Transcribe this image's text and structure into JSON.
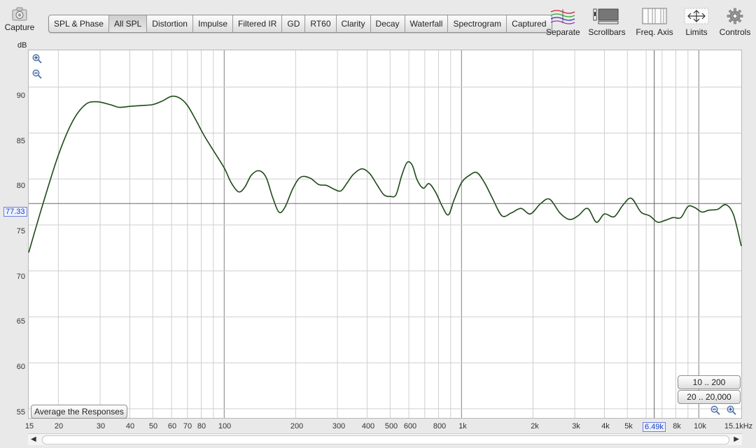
{
  "toolbar": {
    "capture_label": "Capture",
    "tabs": [
      "SPL & Phase",
      "All SPL",
      "Distortion",
      "Impulse",
      "Filtered IR",
      "GD",
      "RT60",
      "Clarity",
      "Decay",
      "Waterfall",
      "Spectrogram",
      "Captured"
    ],
    "active_tab": "All SPL",
    "tools": [
      "Separate",
      "Scrollbars",
      "Freq. Axis",
      "Limits",
      "Controls"
    ]
  },
  "graph": {
    "y_unit": "dB",
    "y_ticks": [
      "90",
      "85",
      "80",
      "75",
      "70",
      "65",
      "60",
      "55"
    ],
    "x_ticks": [
      "15",
      "20",
      "30",
      "40",
      "50",
      "60",
      "70",
      "80",
      "100",
      "200",
      "300",
      "400",
      "500",
      "600",
      "800",
      "1k",
      "2k",
      "3k",
      "4k",
      "5k",
      "6.49k",
      "8k",
      "10k",
      "15.1kHz"
    ],
    "cursor_y_label": "77.33",
    "cursor_x_label": "6.49k",
    "range_buttons": [
      "10 .. 200",
      "20 .. 20,000"
    ],
    "average_button": "Average the Responses"
  },
  "chart_data": {
    "type": "line",
    "xscale": "log",
    "xlim": [
      15,
      15100
    ],
    "ylim": [
      54,
      94
    ],
    "cursor": {
      "x": 6490,
      "y": 77.33
    },
    "series": [
      {
        "color": "#1c4a17",
        "points": [
          [
            15,
            72
          ],
          [
            17,
            76.8
          ],
          [
            20,
            82.6
          ],
          [
            23,
            86.3
          ],
          [
            26,
            88.1
          ],
          [
            29,
            88.4
          ],
          [
            33,
            88.1
          ],
          [
            36,
            87.8
          ],
          [
            40,
            87.9
          ],
          [
            45,
            88
          ],
          [
            50,
            88.1
          ],
          [
            55,
            88.5
          ],
          [
            60,
            89
          ],
          [
            65,
            88.8
          ],
          [
            70,
            88
          ],
          [
            76,
            86.4
          ],
          [
            82,
            84.8
          ],
          [
            90,
            83.1
          ],
          [
            100,
            81.2
          ],
          [
            107,
            79.6
          ],
          [
            115,
            78.6
          ],
          [
            122,
            79.1
          ],
          [
            130,
            80.4
          ],
          [
            140,
            80.9
          ],
          [
            150,
            80.2
          ],
          [
            160,
            78
          ],
          [
            170,
            76.4
          ],
          [
            180,
            76.9
          ],
          [
            195,
            79
          ],
          [
            210,
            80.2
          ],
          [
            230,
            80.1
          ],
          [
            250,
            79.4
          ],
          [
            270,
            79.3
          ],
          [
            290,
            78.9
          ],
          [
            310,
            78.7
          ],
          [
            330,
            79.6
          ],
          [
            350,
            80.5
          ],
          [
            380,
            81.1
          ],
          [
            410,
            80.6
          ],
          [
            440,
            79.4
          ],
          [
            470,
            78.3
          ],
          [
            500,
            78.1
          ],
          [
            530,
            78.3
          ],
          [
            560,
            80.4
          ],
          [
            590,
            81.8
          ],
          [
            620,
            81.5
          ],
          [
            650,
            79.9
          ],
          [
            690,
            79
          ],
          [
            730,
            79.5
          ],
          [
            780,
            78.5
          ],
          [
            830,
            77
          ],
          [
            880,
            76.1
          ],
          [
            930,
            77.7
          ],
          [
            1000,
            79.6
          ],
          [
            1080,
            80.4
          ],
          [
            1160,
            80.7
          ],
          [
            1250,
            79.6
          ],
          [
            1350,
            77.9
          ],
          [
            1480,
            76
          ],
          [
            1620,
            76.3
          ],
          [
            1780,
            76.8
          ],
          [
            1950,
            76.2
          ],
          [
            2150,
            77.3
          ],
          [
            2350,
            77.8
          ],
          [
            2600,
            76.3
          ],
          [
            2850,
            75.6
          ],
          [
            3100,
            76
          ],
          [
            3400,
            76.8
          ],
          [
            3700,
            75.3
          ],
          [
            4000,
            76.2
          ],
          [
            4400,
            75.9
          ],
          [
            4800,
            77.2
          ],
          [
            5200,
            77.9
          ],
          [
            5700,
            76.4
          ],
          [
            6200,
            76
          ],
          [
            6700,
            75.3
          ],
          [
            7200,
            75.5
          ],
          [
            7800,
            75.8
          ],
          [
            8400,
            75.8
          ],
          [
            9000,
            77
          ],
          [
            9600,
            76.9
          ],
          [
            10300,
            76.4
          ],
          [
            11000,
            76.6
          ],
          [
            12000,
            76.7
          ],
          [
            13000,
            77.2
          ],
          [
            14000,
            76.1
          ],
          [
            15100,
            72.7
          ]
        ]
      }
    ]
  }
}
